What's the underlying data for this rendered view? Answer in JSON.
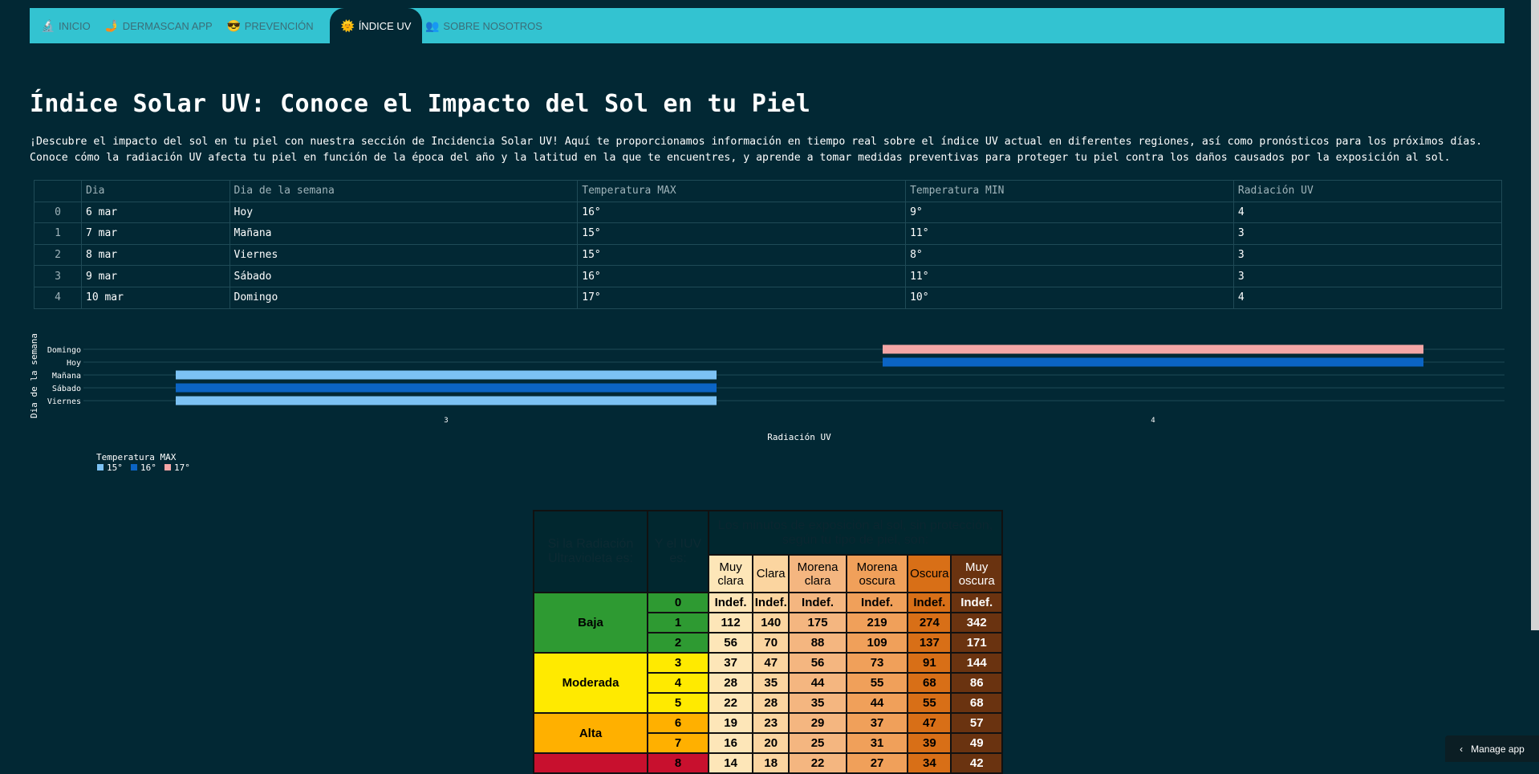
{
  "nav": {
    "items": [
      {
        "label": "INICIO",
        "icon": "🔬",
        "active": false
      },
      {
        "label": "DERMASCAN APP",
        "icon": "🤳",
        "active": false
      },
      {
        "label": "PREVENCIÓN",
        "icon": "😎",
        "active": false
      },
      {
        "label": "ÍNDICE UV",
        "icon": "🌞",
        "active": true
      },
      {
        "label": "SOBRE NOSOTROS",
        "icon": "👥",
        "active": false
      }
    ]
  },
  "page": {
    "title": "Índice Solar UV: Conoce el Impacto del Sol en tu Piel",
    "intro": "¡Descubre el impacto del sol en tu piel con nuestra sección de Incidencia Solar UV! Aquí te proporcionamos información en tiempo real sobre el índice UV actual en diferentes regiones, así como pronósticos para los próximos días. Conoce cómo la radiación UV afecta tu piel en función de la época del año y la latitud en la que te encuentres, y aprende a tomar medidas preventivas para proteger tu piel contra los daños causados por la exposición al sol."
  },
  "forecast": {
    "columns": [
      "",
      "Dia",
      "Dia de la semana",
      "Temperatura MAX",
      "Temperatura MIN",
      "Radiación UV"
    ],
    "rows": [
      [
        "0",
        "6 mar",
        "Hoy",
        "16°",
        "9°",
        "4"
      ],
      [
        "1",
        "7 mar",
        "Mañana",
        "15°",
        "11°",
        "3"
      ],
      [
        "2",
        "8 mar",
        "Viernes",
        "15°",
        "8°",
        "3"
      ],
      [
        "3",
        "9 mar",
        "Sábado",
        "16°",
        "11°",
        "3"
      ],
      [
        "4",
        "10 mar",
        "Domingo",
        "17°",
        "10°",
        "4"
      ]
    ]
  },
  "chart_data": {
    "type": "bar",
    "orientation": "horizontal",
    "xlabel": "Radiación UV",
    "ylabel": "Dia de la semana",
    "categories": [
      "Domingo",
      "Hoy",
      "Mañana",
      "Sábado",
      "Viernes"
    ],
    "x_ticks": [
      "3",
      "4"
    ],
    "legend_title": "Temperatura MAX",
    "legend_position": "bottom-left",
    "bars": [
      {
        "category": "Domingo",
        "value": 4,
        "temp": "17°",
        "color": "#f4a6a6"
      },
      {
        "category": "Hoy",
        "value": 4,
        "temp": "16°",
        "color": "#0b64c4"
      },
      {
        "category": "Mañana",
        "value": 3,
        "temp": "15°",
        "color": "#7cc2f4"
      },
      {
        "category": "Sábado",
        "value": 3,
        "temp": "16°",
        "color": "#0b64c4"
      },
      {
        "category": "Viernes",
        "value": 3,
        "temp": "15°",
        "color": "#7cc2f4"
      }
    ],
    "series": [
      {
        "name": "15°",
        "color": "#7cc2f4"
      },
      {
        "name": "16°",
        "color": "#0b64c4"
      },
      {
        "name": "17°",
        "color": "#f4a6a6"
      }
    ],
    "grid": true
  },
  "uv_table": {
    "header_left": "Si la Radiación Ultravioleta es:",
    "header_mid": "Y el IUV es:",
    "header_top": "Los minutos de exposición al sol, sin protección, según tu tipo de piel, son:",
    "skin_types": [
      "Muy clara",
      "Clara",
      "Morena clara",
      "Morena oscura",
      "Oscura",
      "Muy oscura"
    ],
    "groups": [
      {
        "label": "Baja",
        "color": "#2e9a32",
        "rows": [
          {
            "iuv": "0",
            "vals": [
              "Indef.",
              "Indef.",
              "Indef.",
              "Indef.",
              "Indef.",
              "Indef."
            ]
          },
          {
            "iuv": "1",
            "vals": [
              "112",
              "140",
              "175",
              "219",
              "274",
              "342"
            ]
          },
          {
            "iuv": "2",
            "vals": [
              "56",
              "70",
              "88",
              "109",
              "137",
              "171"
            ]
          }
        ]
      },
      {
        "label": "Moderada",
        "color": "#ffea00",
        "rows": [
          {
            "iuv": "3",
            "vals": [
              "37",
              "47",
              "56",
              "73",
              "91",
              "144"
            ]
          },
          {
            "iuv": "4",
            "vals": [
              "28",
              "35",
              "44",
              "55",
              "68",
              "86"
            ]
          },
          {
            "iuv": "5",
            "vals": [
              "22",
              "28",
              "35",
              "44",
              "55",
              "68"
            ]
          }
        ]
      },
      {
        "label": "Alta",
        "color": "#ffb000",
        "rows": [
          {
            "iuv": "6",
            "vals": [
              "19",
              "23",
              "29",
              "37",
              "47",
              "57"
            ]
          },
          {
            "iuv": "7",
            "vals": [
              "16",
              "20",
              "25",
              "31",
              "39",
              "49"
            ]
          }
        ]
      },
      {
        "label": "",
        "color": "#c8102e",
        "rows": [
          {
            "iuv": "8",
            "vals": [
              "14",
              "18",
              "22",
              "27",
              "34",
              "42"
            ]
          }
        ]
      }
    ]
  },
  "manage_app": {
    "label": "Manage app",
    "icon": "chevron-left"
  }
}
